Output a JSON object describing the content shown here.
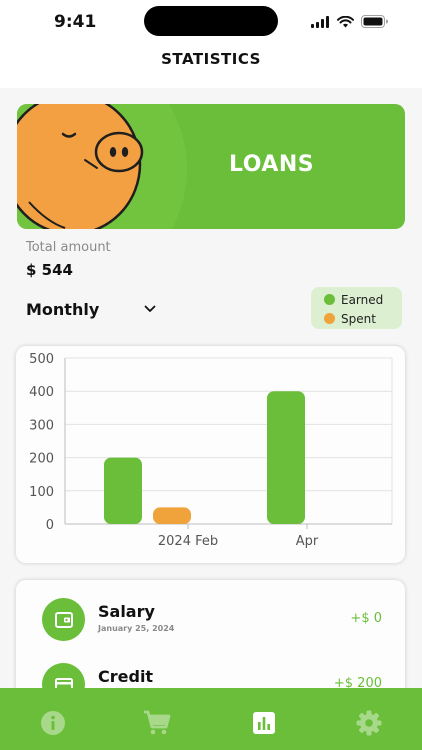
{
  "status_bar": {
    "time": "9:41"
  },
  "header": {
    "title": "STATISTICS"
  },
  "banner": {
    "title": "LOANS"
  },
  "summary": {
    "total_label": "Total amount",
    "total_value": "$ 544"
  },
  "period": {
    "selected": "Monthly"
  },
  "legend": {
    "earned": "Earned",
    "spent": "Spent"
  },
  "colors": {
    "primary": "#6abe3a",
    "accent": "#f0a33a",
    "pig": "#f3a042"
  },
  "chart_data": {
    "type": "bar",
    "ylim": [
      0,
      500
    ],
    "yticks": [
      "0",
      "100",
      "200",
      "300",
      "400",
      "500"
    ],
    "x_tick_labels": [
      "2024 Feb",
      "Apr"
    ],
    "bars": [
      {
        "series": "Earned",
        "value": 200,
        "color": "#6abe3a"
      },
      {
        "series": "Spent",
        "value": 50,
        "color": "#f0a33a"
      },
      {
        "series": "Earned",
        "value": 400,
        "color": "#6abe3a"
      }
    ],
    "grid": true,
    "legend": {
      "placement": "top-right",
      "items": [
        "Earned",
        "Spent"
      ]
    }
  },
  "transactions": [
    {
      "name": "Salary",
      "date": "January 25, 2024",
      "amount": "+$ 0",
      "icon": "wallet-icon"
    },
    {
      "name": "Credit",
      "date": "",
      "amount": "+$ 200",
      "icon": "credit-card-icon"
    }
  ],
  "nav": [
    {
      "name": "info",
      "icon": "info-icon"
    },
    {
      "name": "cart",
      "icon": "cart-icon"
    },
    {
      "name": "statistics",
      "icon": "chart-icon"
    },
    {
      "name": "settings",
      "icon": "gear-icon"
    }
  ]
}
